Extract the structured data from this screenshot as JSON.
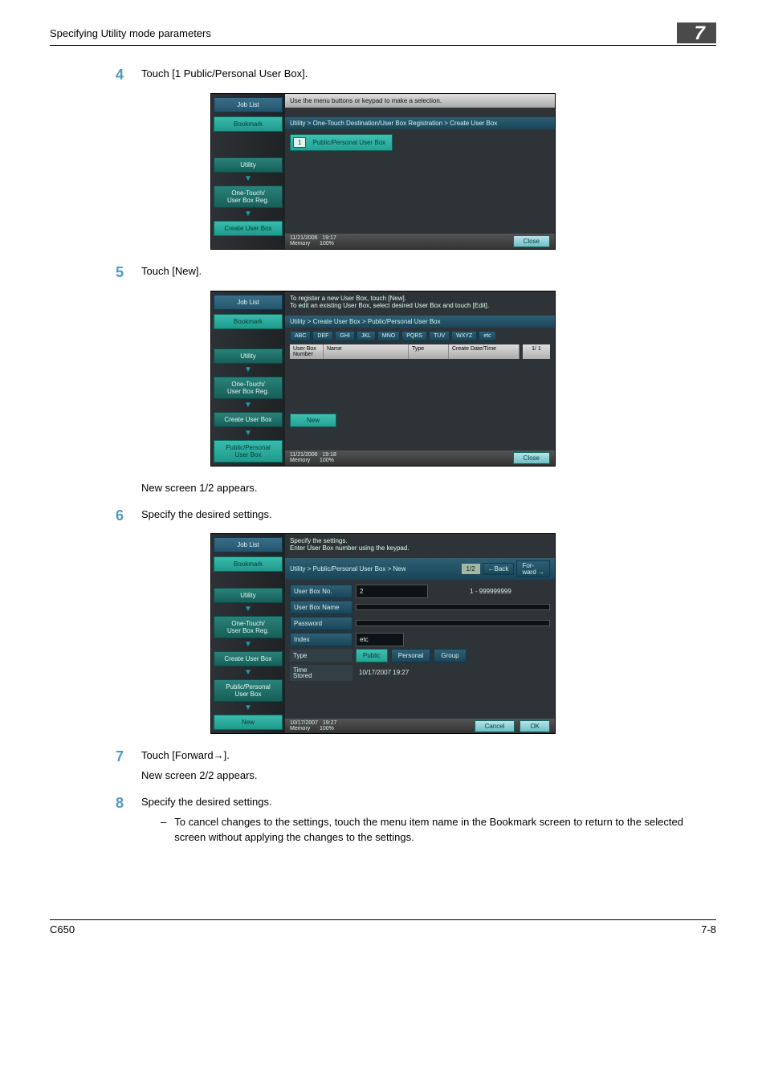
{
  "header": {
    "section_title": "Specifying Utility mode parameters",
    "chapter_no": "7"
  },
  "steps": {
    "s4": {
      "num": "4",
      "text": "Touch [1 Public/Personal User Box]."
    },
    "s5": {
      "num": "5",
      "text": "Touch [New].",
      "after": "New screen 1/2 appears."
    },
    "s6": {
      "num": "6",
      "text": "Specify the desired settings."
    },
    "s7": {
      "num": "7",
      "text": "Touch [Forward→].",
      "after": "New screen 2/2 appears."
    },
    "s8": {
      "num": "8",
      "text": "Specify the desired settings.",
      "bullet": "To cancel changes to the settings, touch the menu item name in the Bookmark screen to return to the selected screen without applying the changes to the settings."
    }
  },
  "shot1": {
    "left": {
      "joblist": "Job List",
      "bookmark": "Bookmark",
      "utility": "Utility",
      "otreg": "One-Touch/\nUser Box Reg.",
      "create": "Create User Box"
    },
    "topmsg": "Use the menu buttons or keypad to make a selection.",
    "crumb": "Utility > One-Touch Destination/User Box Registration > Create User Box",
    "btn_no": "1",
    "btn_label": "Public/Personal User Box",
    "date": "11/21/2006",
    "time": "19:17",
    "memlbl": "Memory",
    "mem": "100%",
    "close": "Close"
  },
  "shot2": {
    "left": {
      "joblist": "Job List",
      "bookmark": "Bookmark",
      "utility": "Utility",
      "otreg": "One-Touch/\nUser Box Reg.",
      "create": "Create User Box",
      "pup": "Public/Personal\nUser Box"
    },
    "topmsg": "To register a new User Box, touch [New].\nTo edit an existing User Box, select desired User Box and touch [Edit].",
    "crumb": "Utility > Create User Box > Public/Personal User Box",
    "tabs": [
      "ABC",
      "DEF",
      "GHI",
      "JKL",
      "MNO",
      "PQRS",
      "TUV",
      "WXYZ",
      "etc"
    ],
    "cols": {
      "num": "User Box\nNumber",
      "name": "Name",
      "type": "Type",
      "date": "Create Date/Time"
    },
    "pager": "1/  1",
    "new_btn": "New",
    "date": "11/21/2006",
    "time": "19:18",
    "memlbl": "Memory",
    "mem": "100%",
    "close": "Close"
  },
  "shot3": {
    "left": {
      "joblist": "Job List",
      "bookmark": "Bookmark",
      "utility": "Utility",
      "otreg": "One-Touch/\nUser Box Reg.",
      "create": "Create User Box",
      "pup": "Public/Personal\nUser Box",
      "new": "New"
    },
    "topmsg": "Specify the settings.\nEnter User Box number using the keypad.",
    "crumb": "Utility > Public/Personal User Box > New",
    "pg": "1/2",
    "back": "←Back",
    "fwd": "For-\nward →",
    "rows": {
      "boxno_lbl": "User Box No.",
      "boxno_val": "2",
      "boxno_range": "1 - 999999999",
      "boxname_lbl": "User Box Name",
      "pw_lbl": "Password",
      "index_lbl": "Index",
      "index_val": "etc",
      "type_lbl": "Type",
      "type_public": "Public",
      "type_personal": "Personal",
      "type_group": "Group",
      "time_lbl": "Time\nStored",
      "time_val": "10/17/2007  19:27"
    },
    "date": "10/17/2007",
    "time": "19:27",
    "memlbl": "Memory",
    "mem": "100%",
    "cancel": "Cancel",
    "ok": "OK"
  },
  "footer": {
    "left": "C650",
    "right": "7-8"
  }
}
